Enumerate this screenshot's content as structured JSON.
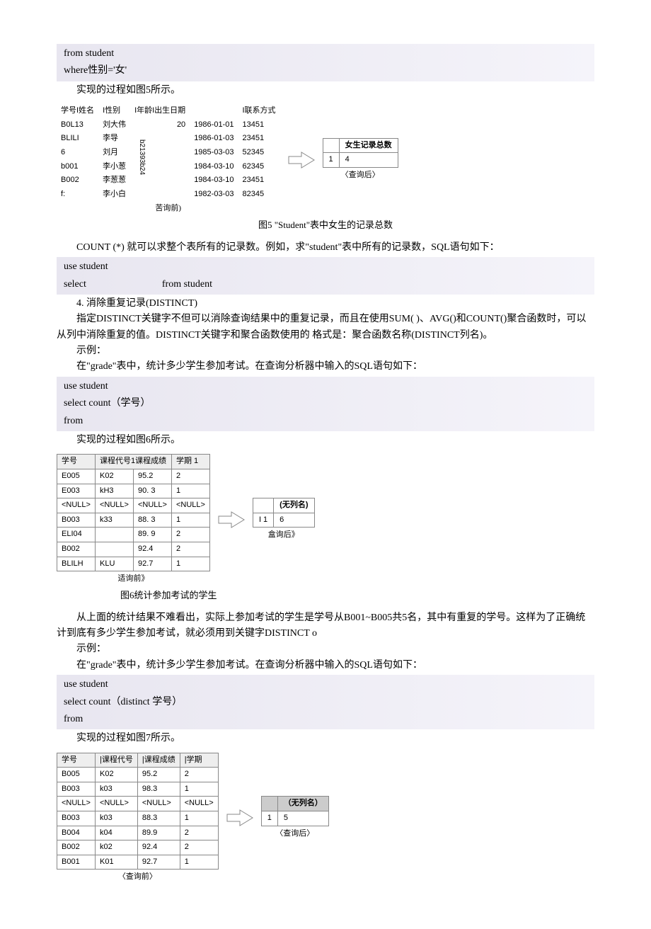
{
  "code1": {
    "l1": "from student",
    "l2": "where性别='女'"
  },
  "text1": "实现的过程如图5所示。",
  "fig5": {
    "headers": [
      "学号I姓名",
      "I性别",
      "I年龄I出生日期",
      "",
      "I联系方式"
    ],
    "rows": [
      [
        "B0L13",
        "刘大伟",
        "",
        "20",
        "1986-01-01",
        "13451"
      ],
      [
        "BLILI",
        "李导",
        "",
        "",
        "1986-01-03",
        "23451"
      ],
      [
        "6",
        "刘月",
        "",
        "",
        "1985-03-03",
        "52345"
      ],
      [
        "b001",
        "李小葱",
        "",
        "",
        "1984-03-10",
        "62345"
      ],
      [
        "B002",
        "李葱葱",
        "",
        "",
        "1984-03-10",
        "23451"
      ],
      [
        "f:",
        "李小白",
        "",
        "",
        "1982-03-03",
        "82345"
      ]
    ],
    "vert": "b21393b24",
    "before": "苦询前)",
    "result_header": "女生记录总数",
    "result_row0": "1",
    "result_val": "4",
    "after": "〈查询后〉",
    "caption": "图5    \"Student\"表中女生的记录总数"
  },
  "para1": "COUNT (*) 就可以求整个表所有的记录数。例如，求\"student\"表中所有的记录数，SQL语句如下：",
  "code2": {
    "l1": "use student",
    "l2a": "select",
    "l2b": "from student"
  },
  "heading4": "4. 消除重复记录(DISTINCT)",
  "para2": "指定DISTINCT关键字不但可以消除查询结果中的重复记录，而且在使用SUM( )、AVG()和COUNT()聚合函数时，可以从列中消除重复的值。DISTINCT关键字和聚合函数使用的 格式是：聚合函数名称(DISTINCT列名)。",
  "example_label": "示例：",
  "para3": "在\"grade\"表中，统计多少学生参加考试。在查询分析器中输入的SQL语句如下：",
  "code3": {
    "l1": "use student",
    "l2": "select    count（学号）",
    "l3": "from"
  },
  "text2": "实现的过程如图6所示。",
  "fig6": {
    "headers": [
      "学号",
      "课程代号1课程成绩",
      "",
      "学期 1"
    ],
    "rows": [
      [
        "E005",
        "K02",
        "95.2",
        "2"
      ],
      [
        "E003",
        "kH3",
        "90. 3",
        "1"
      ],
      [
        "<NULL>",
        "<NULL>",
        "<NULL>",
        "<NULL>"
      ],
      [
        "B003",
        "k33",
        "88. 3",
        "1"
      ],
      [
        "ELI04",
        "",
        "89. 9",
        "2"
      ],
      [
        "B002",
        "",
        "92.4",
        "2"
      ],
      [
        "BLILH",
        "KLU",
        "92.7",
        "1"
      ]
    ],
    "before": "适询前》",
    "result_header": "(无列名)",
    "result_row0": "I 1",
    "result_val": "6",
    "after": "盒询后》",
    "caption": "图6统计参加考试的学生"
  },
  "para4": "从上面的统计结果不难看出，实际上参加考试的学生是学号从B001~B005共5名，其中有重复的学号。这样为了正确统计到底有多少学生参加考试，就必须用到关键字DISTINCT o",
  "para5": "在\"grade\"表中，统计多少学生参加考试。在查询分析器中输入的SQL语句如下：",
  "code4": {
    "l1": "use student",
    "l2": "select count（distinct 学号）",
    "l3": "from"
  },
  "text3": "实现的过程如图7所示。",
  "fig7": {
    "headers": [
      "学号",
      "|课程代号",
      "|课程成绩",
      "|学期"
    ],
    "rows": [
      [
        "B005",
        "K02",
        "95.2",
        "2"
      ],
      [
        "B003",
        "k03",
        "98.3",
        "1"
      ],
      [
        "<NULL>",
        "<NULL>",
        "<NULL>",
        "<NULL>"
      ],
      [
        "B003",
        "k03",
        "88.3",
        "1"
      ],
      [
        "B004",
        "k04",
        "89.9",
        "2"
      ],
      [
        "B002",
        "k02",
        "92.4",
        "2"
      ],
      [
        "B001",
        "K01",
        "92.7",
        "1"
      ]
    ],
    "before": "〈查询前〉",
    "result_header": "（无列名）",
    "result_row0": "1",
    "result_val": "5",
    "after": "〈查询后〉"
  }
}
